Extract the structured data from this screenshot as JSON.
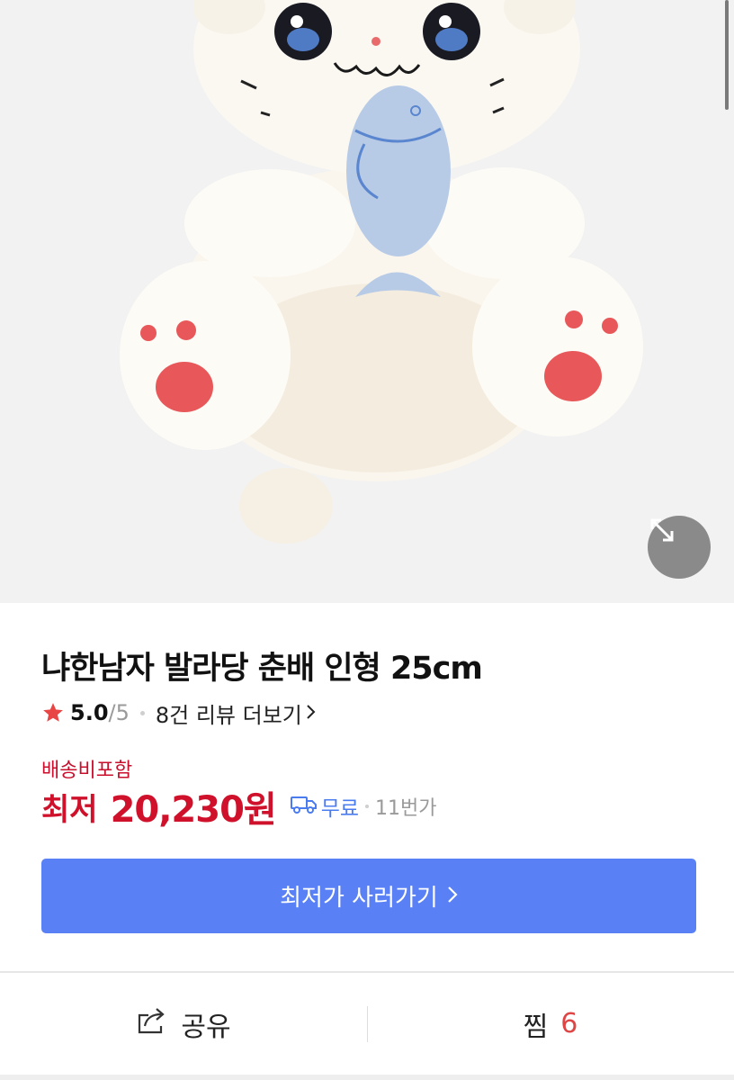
{
  "product": {
    "title": "냐한남자 발라당 춘배 인형 25cm",
    "rating_value": "5.0",
    "rating_max": "/5",
    "review_link": "8건 리뷰 더보기"
  },
  "price": {
    "shipping_note": "배송비포함",
    "label": "최저",
    "value": "20,230원",
    "shipping": "무료",
    "seller": "11번가"
  },
  "actions": {
    "buy_label": "최저가 사러가기",
    "share_label": "공유",
    "wishlist_label": "찜",
    "wishlist_count": "6"
  },
  "colors": {
    "accent": "#5a80f5",
    "price": "#d0112b",
    "free_shipping": "#4a7cf0",
    "star": "#e84545"
  },
  "icons": {
    "expand": "expand-icon",
    "star": "star-icon",
    "truck": "truck-icon",
    "share": "share-icon"
  }
}
